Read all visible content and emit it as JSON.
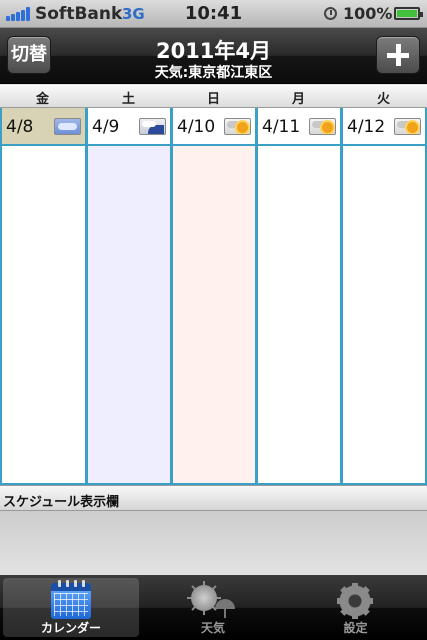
{
  "status_bar": {
    "carrier": "SoftBank",
    "network": "3G",
    "time": "10:41",
    "battery_percent": "100%",
    "icons": [
      "signal-icon",
      "alarm-icon",
      "battery-icon"
    ]
  },
  "nav": {
    "left_button": "切替",
    "title": "2011年4月",
    "subtitle": "天気:東京都江東区",
    "right_button_icon": "plus-icon"
  },
  "weekdays": [
    "金",
    "土",
    "日",
    "月",
    "火"
  ],
  "days": [
    {
      "date": "4/8",
      "weather": "cloudy",
      "today": true
    },
    {
      "date": "4/9",
      "weather": "cloudy-rain",
      "today": false
    },
    {
      "date": "4/10",
      "weather": "cloudy-sunny",
      "today": false
    },
    {
      "date": "4/11",
      "weather": "cloudy-sunny",
      "today": false
    },
    {
      "date": "4/12",
      "weather": "cloudy-sunny",
      "today": false
    }
  ],
  "schedule": {
    "header": "スケジュール表示欄"
  },
  "tabs": [
    {
      "label": "カレンダー",
      "icon": "calendar-icon",
      "active": true
    },
    {
      "label": "天気",
      "icon": "weather-icon",
      "active": false
    },
    {
      "label": "設定",
      "icon": "gear-icon",
      "active": false
    }
  ],
  "colors": {
    "grid_border": "#3aa0c8",
    "saturday_bg": "#eeeeff",
    "sunday_bg": "#fff2ee",
    "today_cell_bg": "#d8d3b4"
  }
}
